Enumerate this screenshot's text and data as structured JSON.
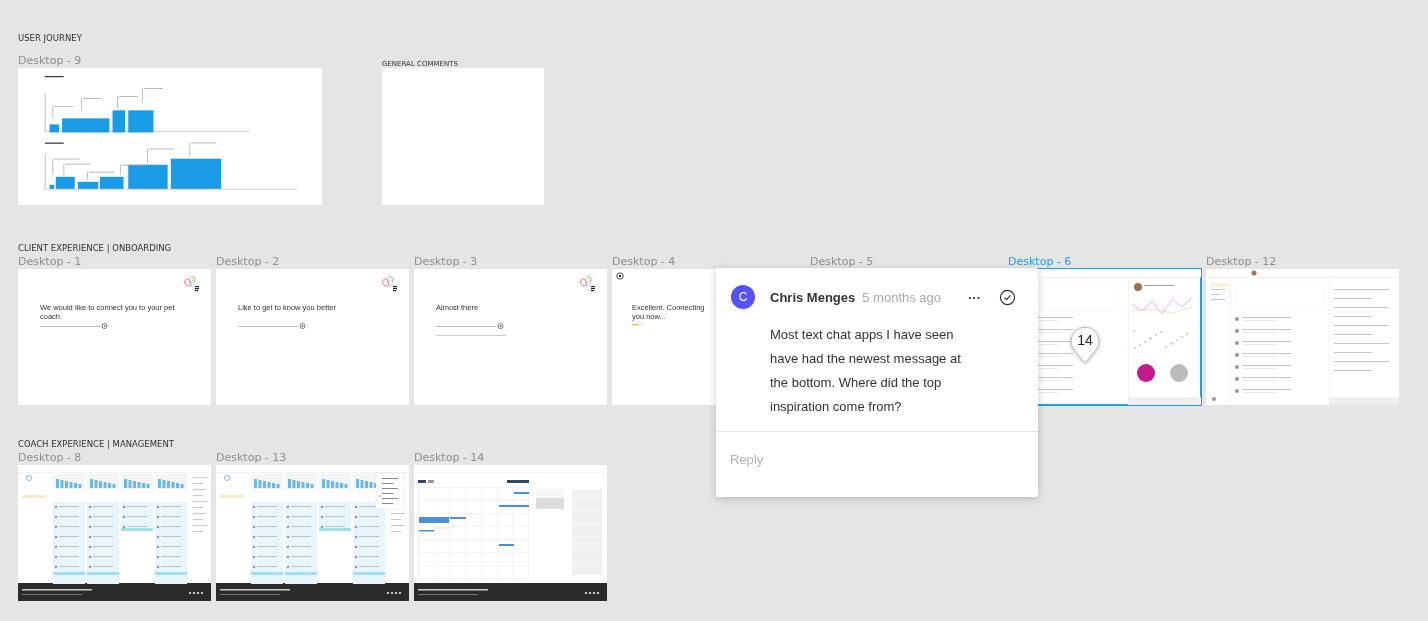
{
  "sections": [
    {
      "title": "USER JOURNEY",
      "frames": [
        {
          "label": "Desktop - 9",
          "kind": "journey",
          "selected": false
        },
        {
          "label": "GENERAL COMMENTS",
          "kind": "blank",
          "selected": false
        }
      ]
    },
    {
      "title": "CLIENT EXPERIENCE | ONBOARDING",
      "frames": [
        {
          "label": "Desktop - 1",
          "kind": "onboarding",
          "selected": false,
          "heading": "We would like to connect you to your pet coach."
        },
        {
          "label": "Desktop - 2",
          "kind": "onboarding",
          "selected": false,
          "heading": "Like to get to know you better"
        },
        {
          "label": "Desktop - 3",
          "kind": "onboarding",
          "selected": false,
          "heading": "Almost there",
          "hint": true
        },
        {
          "label": "Desktop - 4",
          "kind": "connecting",
          "selected": false,
          "heading": "Excellent. Connecting you now..."
        },
        {
          "label": "Desktop - 5",
          "kind": "hidden",
          "selected": false
        },
        {
          "label": "Desktop - 6",
          "kind": "dashboard",
          "selected": true
        },
        {
          "label": "Desktop - 12",
          "kind": "messages",
          "selected": false
        }
      ]
    },
    {
      "title": "COACH EXPERIENCE | MANAGEMENT",
      "frames": [
        {
          "label": "Desktop - 8",
          "kind": "board",
          "selected": false,
          "menu_open": false
        },
        {
          "label": "Desktop - 13",
          "kind": "board",
          "selected": false,
          "menu_open": true
        },
        {
          "label": "Desktop - 14",
          "kind": "calendar",
          "selected": false
        }
      ]
    }
  ],
  "comment_pin": {
    "count": "14"
  },
  "comment": {
    "avatar_initial": "C",
    "author": "Chris Menges",
    "time": "5 months ago",
    "more": "···",
    "body": "Most text chat apps I have seen have had the newest message at the bottom.  Where did the top inspiration come from?",
    "reply_placeholder": "Reply"
  }
}
